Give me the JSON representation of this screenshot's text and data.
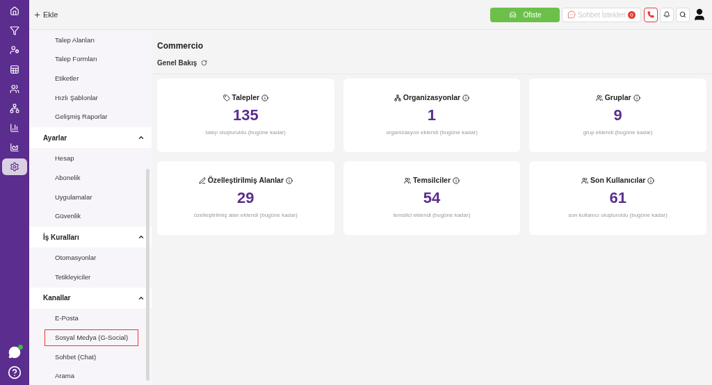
{
  "topbar": {
    "add_label": "Ekle",
    "status_button": "Ofiste",
    "chat_requests": {
      "label": "Sohbet İstekleri",
      "count": "0"
    }
  },
  "rail": {
    "items": [
      {
        "kind": "home",
        "selected": false
      },
      {
        "kind": "filter",
        "selected": false
      },
      {
        "kind": "user-filter",
        "selected": false
      },
      {
        "kind": "table-filter",
        "selected": false
      },
      {
        "kind": "users",
        "selected": false
      },
      {
        "kind": "hierarchy",
        "selected": false
      },
      {
        "kind": "bar-chart",
        "selected": false
      },
      {
        "kind": "area-chart",
        "selected": false
      },
      {
        "kind": "settings",
        "selected": true
      }
    ]
  },
  "sidebar": {
    "sections": [
      {
        "items": [
          {
            "label": "Talep Alanları",
            "selected": false
          },
          {
            "label": "Talep Formları",
            "selected": false
          },
          {
            "label": "Etiketler",
            "selected": false
          },
          {
            "label": "Hızlı Şablonlar",
            "selected": false
          },
          {
            "label": "Gelişmiş Raporlar",
            "selected": false
          }
        ]
      },
      {
        "title": "Ayarlar",
        "expanded": true,
        "items": [
          {
            "label": "Hesap",
            "selected": false
          },
          {
            "label": "Abonelik",
            "selected": false
          },
          {
            "label": "Uygulamalar",
            "selected": false
          },
          {
            "label": "Güvenlik",
            "selected": false
          }
        ]
      },
      {
        "title": "İş Kuralları",
        "expanded": true,
        "items": [
          {
            "label": "Otomasyonlar",
            "selected": false
          },
          {
            "label": "Tetikleyiciler",
            "selected": false
          }
        ]
      },
      {
        "title": "Kanallar",
        "expanded": true,
        "items": [
          {
            "label": "E-Posta",
            "selected": false
          },
          {
            "label": "Sosyal Medya (G-Social)",
            "selected": true
          },
          {
            "label": "Sohbet (Chat)",
            "selected": false
          },
          {
            "label": "Arama",
            "selected": false
          }
        ]
      }
    ]
  },
  "main": {
    "title": "Commercio",
    "subtitle": "Genel Bakış",
    "cards": [
      {
        "kind": "tickets",
        "title": "Talepler",
        "value": "135",
        "caption": "talep oluşturuldu (bugüne kadar)"
      },
      {
        "kind": "organizations",
        "title": "Organizasyonlar",
        "value": "1",
        "caption": "organizasyon eklendi (bugüne kadar)"
      },
      {
        "kind": "groups",
        "title": "Gruplar",
        "value": "9",
        "caption": "grup eklendi (bugüne kadar)"
      },
      {
        "kind": "fields",
        "title": "Özelleştirilmiş Alanlar",
        "value": "29",
        "caption": "özelleştirilmiş alan eklendi (bugüne kadar)"
      },
      {
        "kind": "agents",
        "title": "Temsilciler",
        "value": "54",
        "caption": "temsilci eklendi (bugüne kadar)"
      },
      {
        "kind": "users",
        "title": "Son Kullanıcılar",
        "value": "61",
        "caption": "son kullanıcı oluşturuldu (bugüne kadar)"
      }
    ]
  }
}
